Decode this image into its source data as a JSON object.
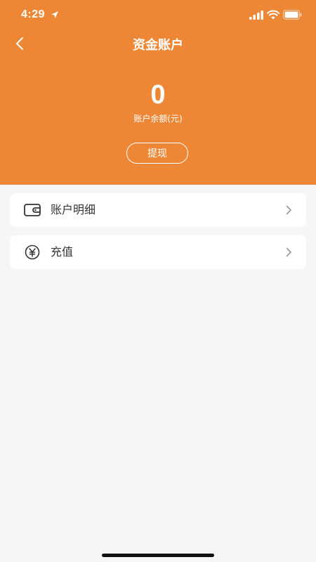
{
  "status_bar": {
    "time": "4:29",
    "icons": [
      "location-arrow-icon",
      "signal-icon",
      "wifi-icon",
      "battery-icon"
    ]
  },
  "header": {
    "title": "资金账户",
    "back_icon": "chevron-left-icon",
    "balance": "0",
    "balance_label": "账户余额(元)",
    "withdraw_label": "提现",
    "background_color": "#ee8735"
  },
  "menu": {
    "items": [
      {
        "label": "账户明细",
        "icon": "wallet-icon"
      },
      {
        "label": "充值",
        "icon": "yuan-icon"
      }
    ]
  }
}
